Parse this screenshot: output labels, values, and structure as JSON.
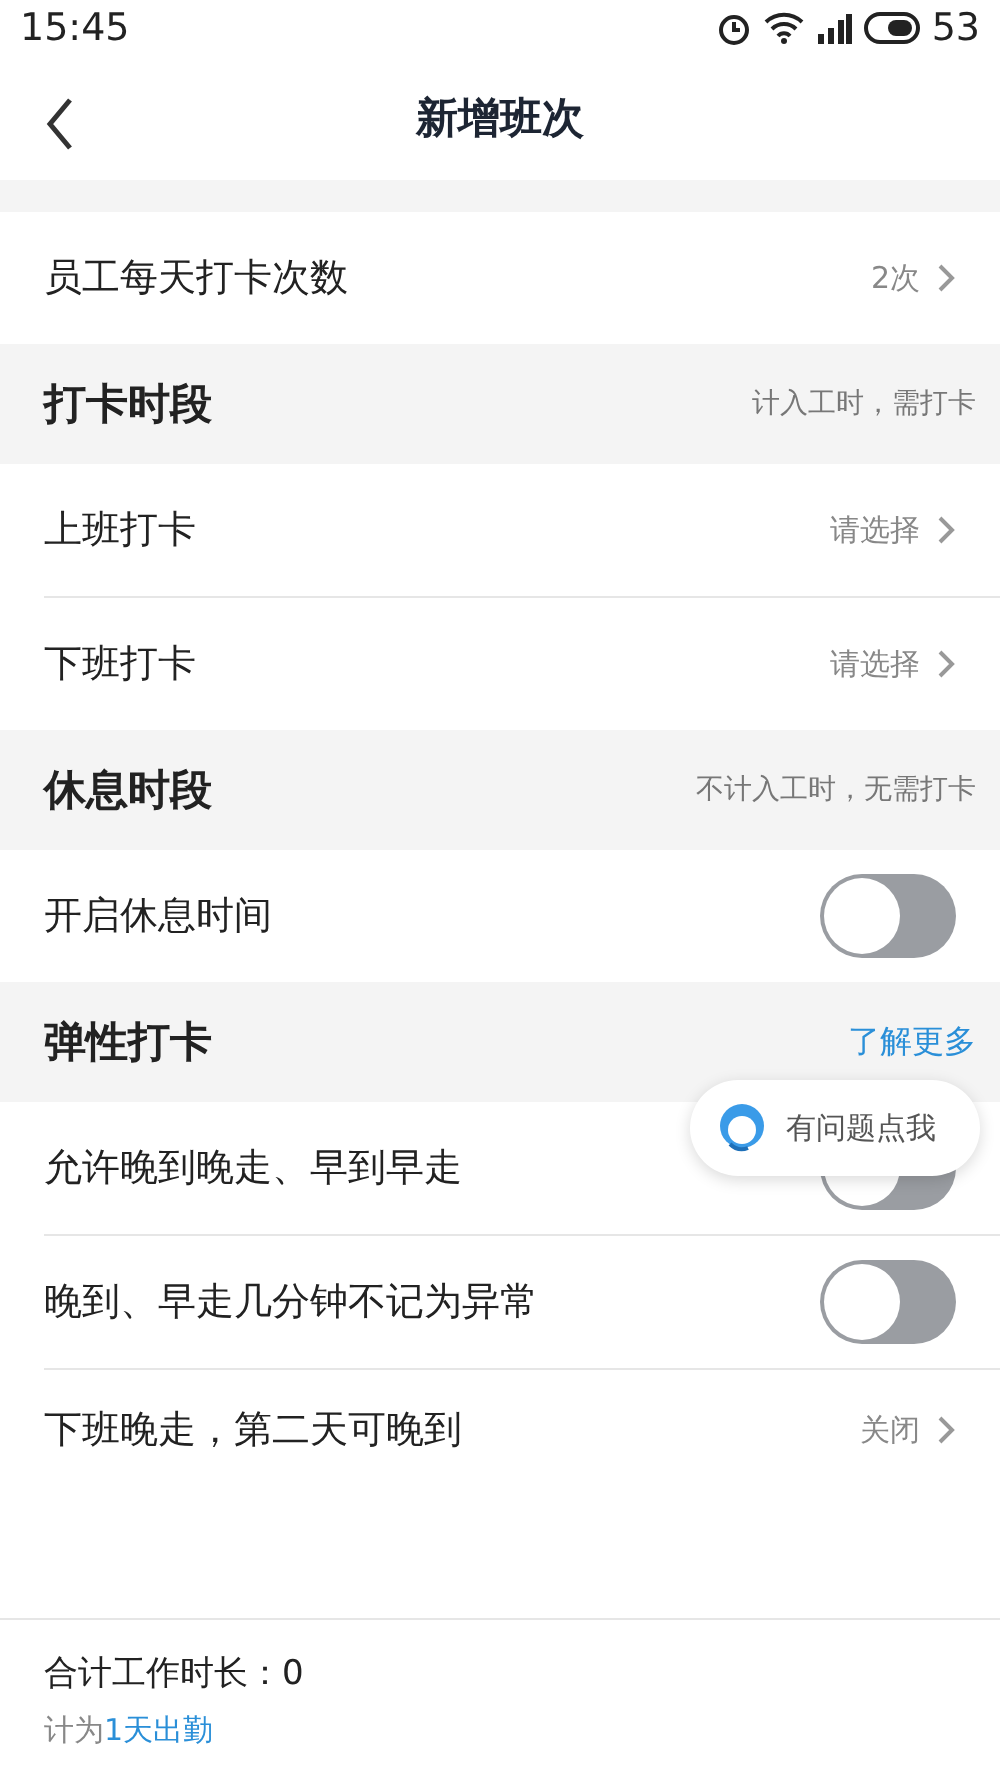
{
  "status_bar": {
    "time": "15:45",
    "battery": "53"
  },
  "nav": {
    "title": "新增班次"
  },
  "sections": [
    {
      "rows": [
        {
          "kind": "select",
          "label": "员工每天打卡次数",
          "value": "2次"
        }
      ]
    },
    {
      "header": {
        "title": "打卡时段",
        "note": "计入工时，需打卡"
      },
      "rows": [
        {
          "kind": "select",
          "label": "上班打卡",
          "value": "请选择"
        },
        {
          "kind": "select",
          "label": "下班打卡",
          "value": "请选择"
        }
      ]
    },
    {
      "header": {
        "title": "休息时段",
        "note": "不计入工时，无需打卡"
      },
      "rows": [
        {
          "kind": "toggle",
          "label": "开启休息时间",
          "on": false
        }
      ]
    },
    {
      "header": {
        "title": "弹性打卡",
        "link": "了解更多"
      },
      "rows": [
        {
          "kind": "toggle",
          "label": "允许晚到晚走、早到早走",
          "on": false
        },
        {
          "kind": "toggle",
          "label": "晚到、早走几分钟不记为异常",
          "on": false
        },
        {
          "kind": "select",
          "label": "下班晚走，第二天可晚到",
          "value": "关闭"
        }
      ]
    }
  ],
  "help_bubble": {
    "label": "有问题点我"
  },
  "footer": {
    "total": "合计工作时长：0",
    "prefix": "计为",
    "highlight": "1天出勤"
  }
}
